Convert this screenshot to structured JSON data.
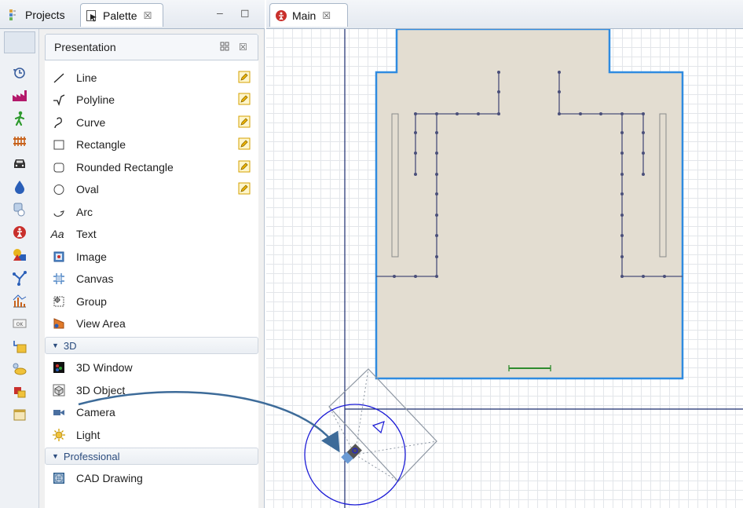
{
  "left_tabs": {
    "projects": "Projects",
    "palette": "Palette",
    "close_symbol": "☒"
  },
  "panel_controls": {
    "minimize": "–",
    "maximize": "◻"
  },
  "palette": {
    "header": "Presentation",
    "header_close": "☒",
    "items": [
      {
        "label": "Line",
        "icon": "line-tool-icon",
        "editable": true
      },
      {
        "label": "Polyline",
        "icon": "polyline-tool-icon",
        "editable": true
      },
      {
        "label": "Curve",
        "icon": "curve-tool-icon",
        "editable": true
      },
      {
        "label": "Rectangle",
        "icon": "rectangle-tool-icon",
        "editable": true
      },
      {
        "label": "Rounded Rectangle",
        "icon": "rounded-rectangle-tool-icon",
        "editable": true
      },
      {
        "label": "Oval",
        "icon": "oval-tool-icon",
        "editable": true
      },
      {
        "label": "Arc",
        "icon": "arc-tool-icon",
        "editable": false
      },
      {
        "label": "Text",
        "icon": "text-tool-icon",
        "text_glyph": "Aa",
        "editable": false
      },
      {
        "label": "Image",
        "icon": "image-tool-icon",
        "editable": false
      },
      {
        "label": "Canvas",
        "icon": "canvas-tool-icon",
        "editable": false
      },
      {
        "label": "Group",
        "icon": "group-tool-icon",
        "editable": false
      },
      {
        "label": "View Area",
        "icon": "view-area-tool-icon",
        "editable": false
      }
    ],
    "section_3d": "3D",
    "items_3d": [
      {
        "label": "3D Window",
        "icon": "3d-window-icon"
      },
      {
        "label": "3D Object",
        "icon": "3d-object-icon"
      },
      {
        "label": "Camera",
        "icon": "camera-icon"
      },
      {
        "label": "Light",
        "icon": "light-icon"
      }
    ],
    "section_professional": "Professional",
    "items_professional": [
      {
        "label": "CAD Drawing",
        "icon": "cad-drawing-icon"
      }
    ]
  },
  "strip_icons": [
    "statechart-icon",
    "process-modeling-icon",
    "pedestrian-icon",
    "rail-icon",
    "road-traffic-icon",
    "fluid-icon",
    "agent-icon",
    "system-dynamics-icon",
    "presentation-icon",
    "space-markup-icon",
    "analysis-icon",
    "controls-icon",
    "connectivity-icon",
    "pictures-icon",
    "3d-objects-icon",
    "misc-icon"
  ],
  "main_tab": {
    "label": "Main",
    "close_symbol": "☒"
  },
  "colors": {
    "floor_fill": "#e3ddd1",
    "wall_stroke": "#2f8be0",
    "node_color": "#4a4f7a",
    "scale_bar": "#2e8b2e",
    "camera_circle": "#1c1cd6",
    "arrow": "#3d6b99"
  }
}
